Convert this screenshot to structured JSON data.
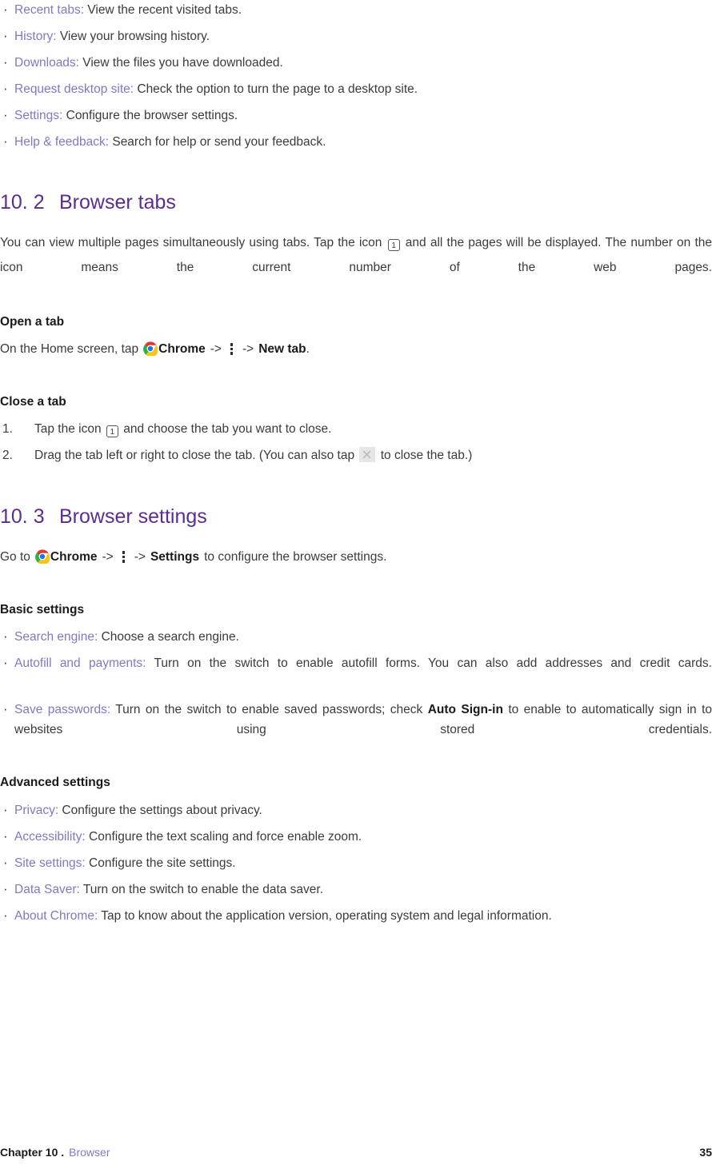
{
  "menu_bullets": [
    {
      "term": "Recent tabs:",
      "desc": " View the recent visited tabs."
    },
    {
      "term": "History:",
      "desc": " View your browsing history."
    },
    {
      "term": "Downloads:",
      "desc": " View the files you have downloaded."
    },
    {
      "term": "Request desktop site:",
      "desc": " Check the option to turn the page to a desktop site."
    },
    {
      "term": "Settings:",
      "desc": " Configure the browser settings."
    },
    {
      "term": "Help & feedback:",
      "desc": " Search for help or send your feedback."
    }
  ],
  "section_tabs": {
    "number": "10. 2",
    "title": "Browser tabs",
    "intro_part1": "You can view multiple pages simultaneously using tabs. Tap the icon",
    "tab_count_icon_label": "1",
    "intro_part2": "and all the pages will be displayed. The number on the icon means the current number of the web pages."
  },
  "open_a_tab": {
    "heading": "Open a tab",
    "line_part1": "On the Home screen, tap",
    "chrome_label": "Chrome",
    "arrow1": "->",
    "arrow2": "->",
    "new_tab_label": "New tab",
    "period": "."
  },
  "close_a_tab": {
    "heading": "Close a tab",
    "steps": [
      {
        "index": "1.",
        "part1": "Tap the icon",
        "icon_label": "1",
        "part2": "and choose the tab you want to close."
      },
      {
        "index": "2.",
        "part1": "Drag the tab left or right to close the tab. (You can also tap",
        "part2": "to close the tab.)"
      }
    ]
  },
  "section_settings": {
    "number": "10. 3",
    "title": "Browser settings",
    "line_part1": "Go to",
    "chrome_label": "Chrome",
    "arrow1": "->",
    "arrow2": "->",
    "settings_label": "Settings",
    "line_part2": "to configure the browser settings."
  },
  "basic_settings": {
    "heading": "Basic settings",
    "items": [
      {
        "term": "Search engine:",
        "desc": " Choose a search engine.",
        "justify": false
      },
      {
        "term": "Autofill and payments:",
        "desc": " Turn on the switch to enable autofill forms. You can also add addresses and credit cards.",
        "justify": true
      },
      {
        "term": "Save passwords:",
        "desc_pre": " Turn on the switch to enable saved passwords; check ",
        "bold": "Auto Sign-in",
        "desc_post": " to enable to automatically sign in to websites using stored credentials.",
        "justify": true
      }
    ]
  },
  "advanced_settings": {
    "heading": "Advanced settings",
    "items": [
      {
        "term": "Privacy:",
        "desc": " Configure the settings about privacy."
      },
      {
        "term": "Accessibility:",
        "desc": " Configure the text scaling and force enable zoom."
      },
      {
        "term": "Site settings:",
        "desc": " Configure the site settings."
      },
      {
        "term": "Data Saver:",
        "desc": " Turn on the switch to enable the data saver."
      },
      {
        "term": "About Chrome:",
        "desc": " Tap to know about the application version, operating system and legal information."
      }
    ]
  },
  "footer": {
    "chapter": "Chapter 10 .",
    "chapter_name": "Browser",
    "page_number": "35"
  },
  "colors": {
    "heading_purple": "#5c2d91",
    "link_purple": "#8476c4",
    "body_gray": "#3b3b3b",
    "icon_bg_gray": "#e6e6e6"
  },
  "icons": {
    "chrome": "chrome-logo-icon",
    "kebab": "more-vertical-icon",
    "tab_count": "tab-count-icon",
    "close": "close-x-icon"
  }
}
